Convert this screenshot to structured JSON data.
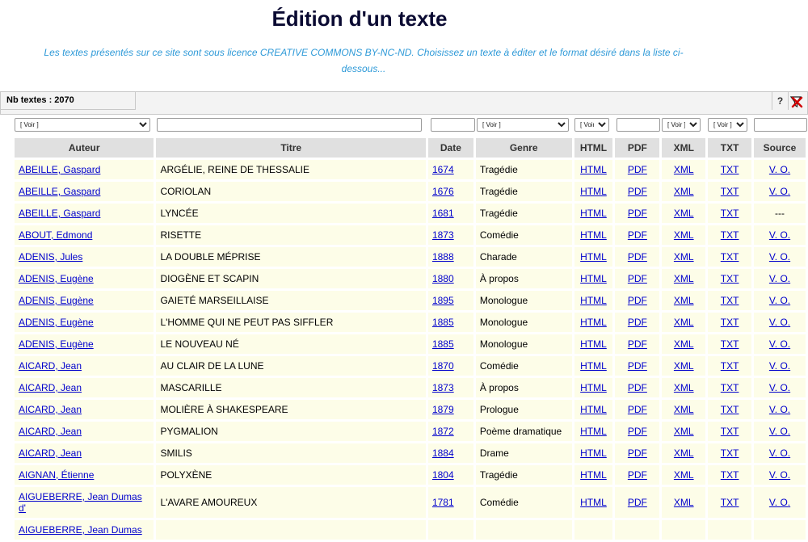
{
  "page": {
    "title": "Édition d'un texte",
    "notice": "Les textes présentés sur ce site sont sous licence CREATIVE COMMONS BY-NC-ND. Choisissez un texte à éditer et le format désiré dans la liste ci-dessous..."
  },
  "toolbar": {
    "count_label": "Nb textes : 2070",
    "help_label": "?"
  },
  "filters": {
    "auteur": "[ Voir ]",
    "titre": "",
    "date": "",
    "genre": "[ Voir ]",
    "html": "[ Voir ]",
    "pdf_text": "",
    "pdf": "[ Voir ]",
    "txt": "[ Voir ]",
    "source": ""
  },
  "columns": [
    "Auteur",
    "Titre",
    "Date",
    "Genre",
    "HTML",
    "PDF",
    "XML",
    "TXT",
    "Source"
  ],
  "rows": [
    {
      "auteur": "ABEILLE, Gaspard",
      "titre": "ARGÉLIE, REINE DE THESSALIE",
      "date": "1674",
      "genre": "Tragédie",
      "html": "HTML",
      "pdf": "PDF",
      "xml": "XML",
      "txt": "TXT",
      "source": "V. O."
    },
    {
      "auteur": "ABEILLE, Gaspard",
      "titre": "CORIOLAN",
      "date": "1676",
      "genre": "Tragédie",
      "html": "HTML",
      "pdf": "PDF",
      "xml": "XML",
      "txt": "TXT",
      "source": "V. O."
    },
    {
      "auteur": "ABEILLE, Gaspard",
      "titre": "LYNCÉE",
      "date": "1681",
      "genre": "Tragédie",
      "html": "HTML",
      "pdf": "PDF",
      "xml": "XML",
      "txt": "TXT",
      "source": "---"
    },
    {
      "auteur": "ABOUT, Edmond",
      "titre": "RISETTE",
      "date": "1873",
      "genre": "Comédie",
      "html": "HTML",
      "pdf": "PDF",
      "xml": "XML",
      "txt": "TXT",
      "source": "V. O."
    },
    {
      "auteur": "ADENIS, Jules",
      "titre": "LA DOUBLE MÉPRISE",
      "date": "1888",
      "genre": "Charade",
      "html": "HTML",
      "pdf": "PDF",
      "xml": "XML",
      "txt": "TXT",
      "source": "V. O."
    },
    {
      "auteur": "ADENIS, Eugène",
      "titre": "DIOGÈNE ET SCAPIN",
      "date": "1880",
      "genre": "À propos",
      "html": "HTML",
      "pdf": "PDF",
      "xml": "XML",
      "txt": "TXT",
      "source": "V. O."
    },
    {
      "auteur": "ADENIS, Eugène",
      "titre": "GAIETÉ MARSEILLAISE",
      "date": "1895",
      "genre": "Monologue",
      "html": "HTML",
      "pdf": "PDF",
      "xml": "XML",
      "txt": "TXT",
      "source": "V. O."
    },
    {
      "auteur": "ADENIS, Eugène",
      "titre": "L'HOMME QUI NE PEUT PAS SIFFLER",
      "date": "1885",
      "genre": "Monologue",
      "html": "HTML",
      "pdf": "PDF",
      "xml": "XML",
      "txt": "TXT",
      "source": "V. O."
    },
    {
      "auteur": "ADENIS, Eugène",
      "titre": "LE NOUVEAU NÉ",
      "date": "1885",
      "genre": "Monologue",
      "html": "HTML",
      "pdf": "PDF",
      "xml": "XML",
      "txt": "TXT",
      "source": "V. O."
    },
    {
      "auteur": "AICARD, Jean",
      "titre": "AU CLAIR DE LA LUNE",
      "date": "1870",
      "genre": "Comédie",
      "html": "HTML",
      "pdf": "PDF",
      "xml": "XML",
      "txt": "TXT",
      "source": "V. O."
    },
    {
      "auteur": "AICARD, Jean",
      "titre": "MASCARILLE",
      "date": "1873",
      "genre": "À propos",
      "html": "HTML",
      "pdf": "PDF",
      "xml": "XML",
      "txt": "TXT",
      "source": "V. O."
    },
    {
      "auteur": "AICARD, Jean",
      "titre": "MOLIÈRE À SHAKESPEARE",
      "date": "1879",
      "genre": "Prologue",
      "html": "HTML",
      "pdf": "PDF",
      "xml": "XML",
      "txt": "TXT",
      "source": "V. O."
    },
    {
      "auteur": "AICARD, Jean",
      "titre": "PYGMALION",
      "date": "1872",
      "genre": "Poème dramatique",
      "html": "HTML",
      "pdf": "PDF",
      "xml": "XML",
      "txt": "TXT",
      "source": "V. O."
    },
    {
      "auteur": "AICARD, Jean",
      "titre": "SMILIS",
      "date": "1884",
      "genre": "Drame",
      "html": "HTML",
      "pdf": "PDF",
      "xml": "XML",
      "txt": "TXT",
      "source": "V. O."
    },
    {
      "auteur": "AIGNAN, Étienne",
      "titre": "POLYXÈNE",
      "date": "1804",
      "genre": "Tragédie",
      "html": "HTML",
      "pdf": "PDF",
      "xml": "XML",
      "txt": "TXT",
      "source": "V. O."
    },
    {
      "auteur": "AIGUEBERRE, Jean Dumas d'",
      "titre": "L'AVARE AMOUREUX",
      "date": "1781",
      "genre": "Comédie",
      "html": "HTML",
      "pdf": "PDF",
      "xml": "XML",
      "txt": "TXT",
      "source": "V. O."
    },
    {
      "auteur": "AIGUEBERRE, Jean Dumas",
      "titre": "",
      "date": "",
      "genre": "",
      "html": "",
      "pdf": "",
      "xml": "",
      "txt": "",
      "source": ""
    }
  ],
  "colors": {
    "row_bg": "#fdfde8",
    "header_bg": "#e0e0e0",
    "link": "#0000cc",
    "notice": "#2f9ad8",
    "title": "#0a0a32"
  }
}
